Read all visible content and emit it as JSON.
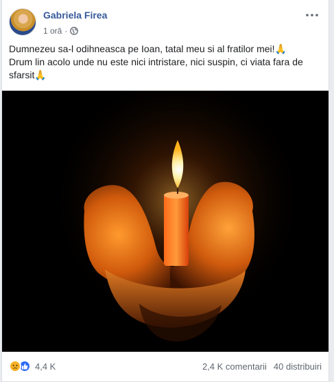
{
  "post": {
    "author": "Gabriela Firea",
    "time": "1 oră",
    "separator": "·",
    "text_line1": "Dumnezeu sa-l odihneasca pe Ioan, tatal meu si al fratilor mei!",
    "text_line2": "Drum lin acolo unde nu este nici intristare, nici suspin, ci viata fara de sfarsit",
    "pray_emoji": "🙏",
    "privacy_icon": "globe-icon",
    "menu_icon": "more-horizontal-icon"
  },
  "footer": {
    "reaction_icons": [
      "sad-reaction-icon",
      "like-reaction-icon"
    ],
    "reactions_count": "4,4 K",
    "comments": "2,4 K comentarii",
    "shares": "40 distribuiri"
  },
  "colors": {
    "link": "#365899",
    "meta": "#616770",
    "like": "#2d6cf6",
    "sad": "#f7b125"
  }
}
